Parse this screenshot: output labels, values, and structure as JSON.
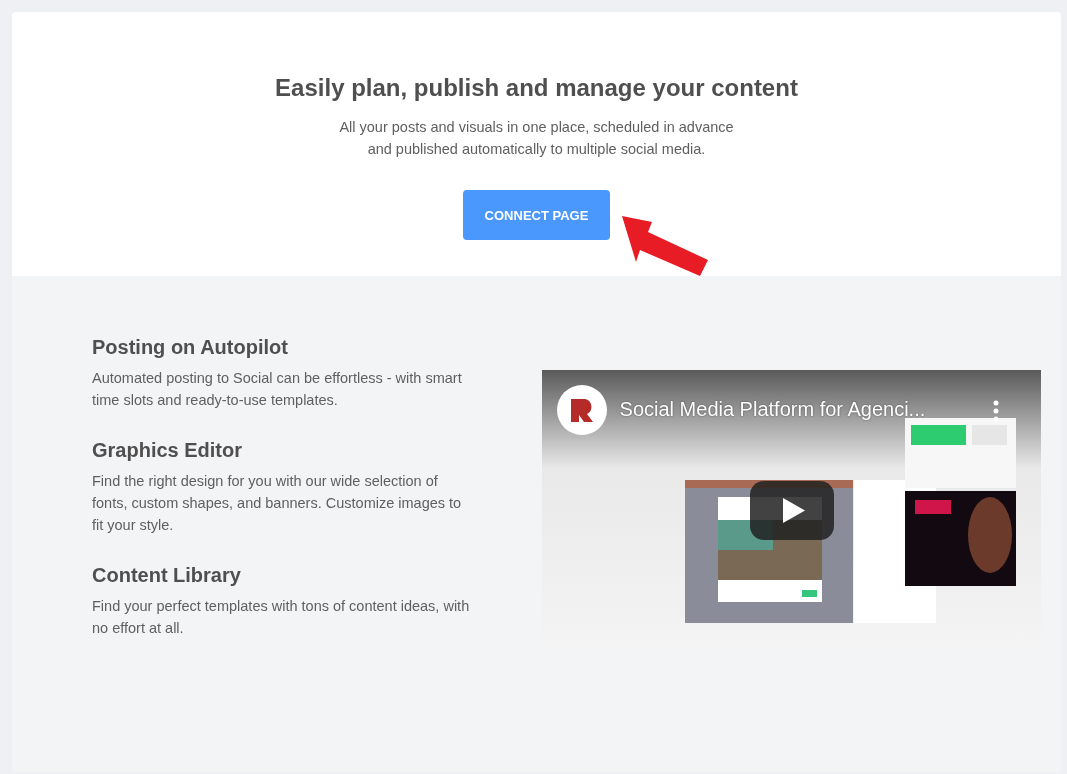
{
  "hero": {
    "title": "Easily plan, publish and manage your content",
    "subtitle_lines": [
      "All your posts and visuals in one place, scheduled in advance",
      "and published automatically to multiple social media."
    ],
    "button": "CONNECT PAGE"
  },
  "features": [
    {
      "title": "Posting on Autopilot",
      "text": "Automated posting to Social can be effortless - with smart time slots and ready-to-use templates."
    },
    {
      "title": "Graphics Editor",
      "text": "Find the right design for you with our wide selection of fonts, custom shapes, and banners. Customize images to fit your style."
    },
    {
      "title": "Content Library",
      "text": "Find your perfect templates with tons of content ideas, with no effort at all."
    }
  ],
  "video": {
    "title": "Social Media Platform for Agenci..."
  }
}
